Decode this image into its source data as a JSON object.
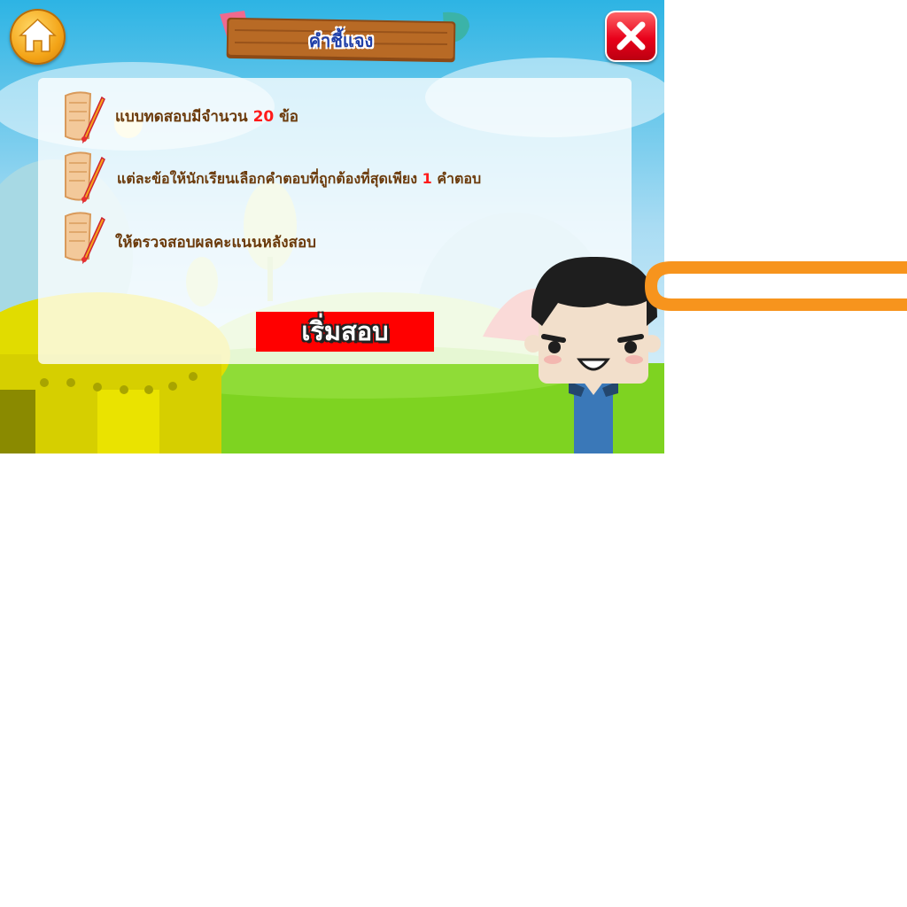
{
  "header": {
    "title": "คำชี้แจง"
  },
  "buttons": {
    "home_icon": "home-icon",
    "close_icon": "close-icon",
    "start_label": "เริ่มสอบ"
  },
  "instructions": [
    {
      "prefix": "แบบทดสอบมีจำนวน ",
      "highlight": "20",
      "suffix": " ข้อ"
    },
    {
      "prefix": "แต่ละข้อให้นักเรียนเลือกคำตอบที่ถูกต้องที่สุดเพียง ",
      "highlight": "1",
      "suffix": " คำตอบ"
    },
    {
      "prefix": "ให้ตรวจสอบผลคะแนนหลังสอบ",
      "highlight": "",
      "suffix": ""
    }
  ],
  "colors": {
    "sky": "#39b8e6",
    "grass": "#7ed321",
    "accent_red": "#ff0000",
    "text_brown": "#6b3a0b",
    "orange_bar": "#f7941d"
  }
}
